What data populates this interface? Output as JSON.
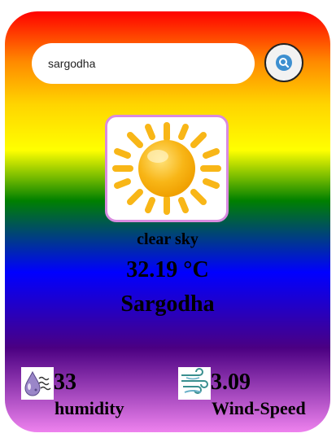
{
  "search": {
    "value": "sargodha",
    "placeholder": ""
  },
  "weather": {
    "condition": "clear sky",
    "temperature": "32.19 °C",
    "city": "Sargodha",
    "icon": "sun-icon"
  },
  "stats": {
    "humidity": {
      "value": "33",
      "label": "humidity",
      "icon": "humidity-icon"
    },
    "wind": {
      "value": "3.09",
      "label": "Wind-Speed",
      "icon": "wind-icon"
    }
  },
  "colors": {
    "gradient": [
      "#ff0000",
      "#ff8a00",
      "#ffff00",
      "#008000",
      "#0000ff",
      "#4b0082",
      "#ee82ee"
    ],
    "search_icon": "#3d8fd0",
    "sun": "#f8b617"
  }
}
